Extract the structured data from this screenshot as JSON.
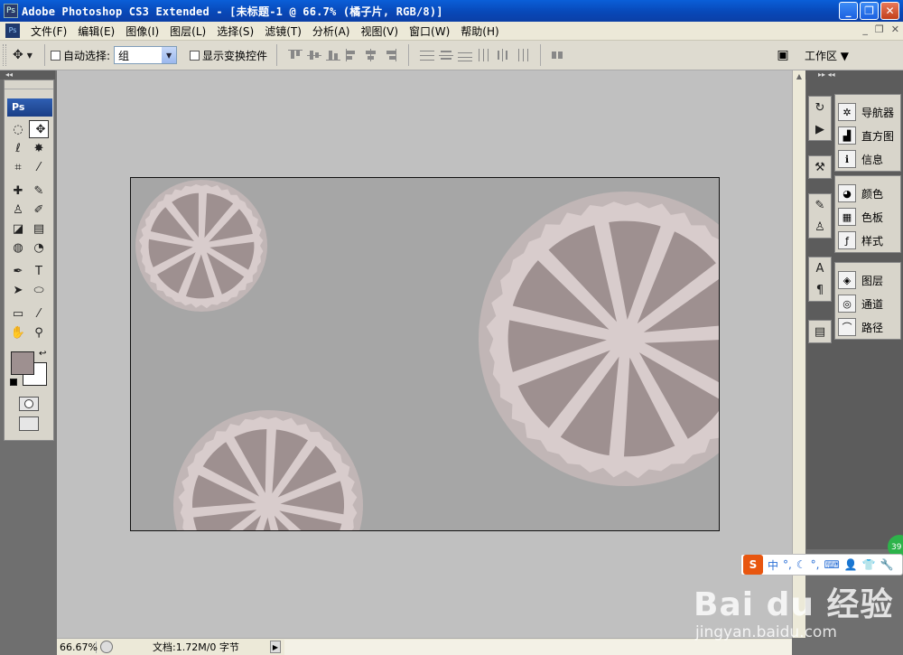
{
  "window": {
    "app_icon": "Ps",
    "title": "Adobe Photoshop CS3 Extended - [未标题-1 @ 66.7% (橘子片, RGB/8)]",
    "buttons": [
      "_",
      "❐",
      "✕"
    ]
  },
  "menu": {
    "app_icon": "Ps",
    "items": [
      "文件(F)",
      "编辑(E)",
      "图像(I)",
      "图层(L)",
      "选择(S)",
      "滤镜(T)",
      "分析(A)",
      "视图(V)",
      "窗口(W)",
      "帮助(H)"
    ],
    "doc_buttons": [
      "_",
      "❐",
      "✕"
    ]
  },
  "options": {
    "tool_icon": "✥",
    "auto_select_label": "自动选择:",
    "auto_select_value": "组",
    "show_transform_label": "显示变换控件",
    "workspace_label": "工作区 ▼"
  },
  "toolbox": {
    "logo": "Ps",
    "foreground_color": "#9e9090",
    "background_color": "#ffffff"
  },
  "panels": {
    "group1": [
      "导航器",
      "直方图",
      "信息"
    ],
    "group2": [
      "颜色",
      "色板",
      "样式"
    ],
    "group3": [
      "图层",
      "通道",
      "路径"
    ]
  },
  "status": {
    "zoom": "66.67%",
    "doc_info": "文档:1.72M/0 字节"
  },
  "canvas": {
    "layer_name": "橘子片",
    "background_color": "#a6a6a6",
    "rind_color": "#c1b6b6",
    "pith_color": "#d8cccc",
    "segment_color": "#9e9090"
  },
  "overlay": {
    "ime_brand": "S",
    "ime_items": [
      "中",
      "°,",
      "☾",
      "°,",
      "⌨",
      "👤",
      "👕",
      "🔧"
    ],
    "badge": "39",
    "watermark_big": "Bai du 经验",
    "watermark_small": "jingyan.baidu.com"
  }
}
